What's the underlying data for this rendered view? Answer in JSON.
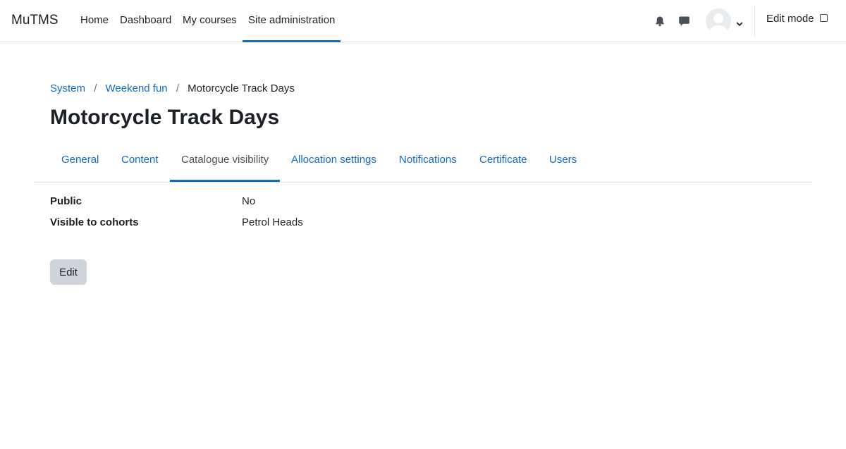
{
  "brand": "MuTMS",
  "nav": {
    "items": [
      {
        "label": "Home"
      },
      {
        "label": "Dashboard"
      },
      {
        "label": "My courses"
      },
      {
        "label": "Site administration"
      }
    ],
    "active": "Site administration"
  },
  "header_icons": [
    "bell-icon",
    "chat-icon",
    "avatar",
    "chevron-down-icon"
  ],
  "edit_mode": {
    "label": "Edit mode",
    "checked": false
  },
  "breadcrumb": {
    "items": [
      {
        "label": "System"
      },
      {
        "label": "Weekend fun"
      },
      {
        "label": "Motorcycle Track Days"
      }
    ],
    "separator": "/"
  },
  "page_title": "Motorcycle Track Days",
  "tabs": {
    "items": [
      {
        "label": "General"
      },
      {
        "label": "Content"
      },
      {
        "label": "Catalogue visibility"
      },
      {
        "label": "Allocation settings"
      },
      {
        "label": "Notifications"
      },
      {
        "label": "Certificate"
      },
      {
        "label": "Users"
      }
    ],
    "active": "Catalogue visibility"
  },
  "details": [
    {
      "label": "Public",
      "value": "No"
    },
    {
      "label": "Visible to cohorts",
      "value": "Petrol Heads"
    }
  ],
  "edit_button": "Edit",
  "colors": {
    "accent": "#0f6cbf",
    "text": "#1d2125",
    "button_bg": "#ced4da",
    "border": "#dee2e6"
  }
}
